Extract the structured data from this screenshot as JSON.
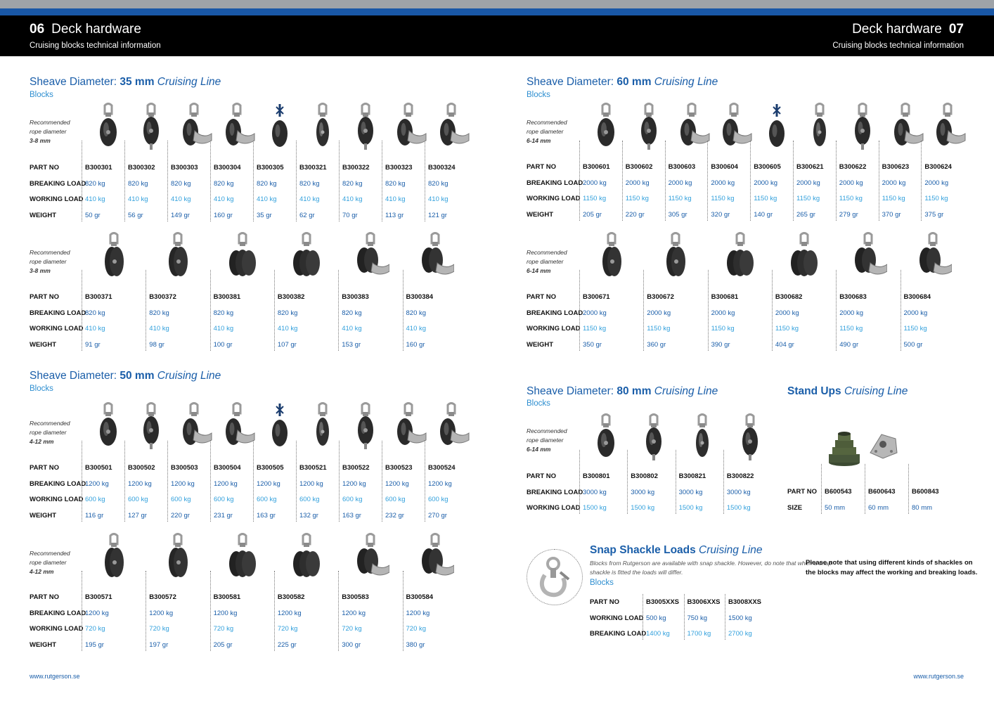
{
  "header": {
    "left_num": "06",
    "left_title": "Deck hardware",
    "left_sub": "Cruising blocks technical information",
    "right_num": "07",
    "right_title": "Deck hardware",
    "right_sub": "Cruising blocks technical information"
  },
  "labels": {
    "rec1": "Recommended",
    "rec2": "rope diameter",
    "part_no": "PART NO",
    "breaking": "BREAKING LOAD",
    "working": "WORKING LOAD",
    "weight": "WEIGHT",
    "size": "SIZE"
  },
  "s35": {
    "title_pre": "Sheave Diameter: ",
    "title_bold": "35 mm",
    "title_it": " Cruising Line",
    "sub": "Blocks",
    "rope": "3-8 mm",
    "t1": {
      "parts": [
        "B300301",
        "B300302",
        "B300303",
        "B300304",
        "B300305",
        "B300321",
        "B300322",
        "B300323",
        "B300324"
      ],
      "breaking": [
        "820 kg",
        "820 kg",
        "820 kg",
        "820 kg",
        "820 kg",
        "820 kg",
        "820 kg",
        "820 kg",
        "820 kg"
      ],
      "working": [
        "410 kg",
        "410 kg",
        "410 kg",
        "410 kg",
        "410 kg",
        "410 kg",
        "410 kg",
        "410 kg",
        "410 kg"
      ],
      "weight": [
        "50 gr",
        "56 gr",
        "149 gr",
        "160 gr",
        "35 gr",
        "62 gr",
        "70 gr",
        "113 gr",
        "121 gr"
      ]
    },
    "t2": {
      "parts": [
        "B300371",
        "B300372",
        "B300381",
        "B300382",
        "B300383",
        "B300384"
      ],
      "breaking": [
        "820 kg",
        "820 kg",
        "820 kg",
        "820 kg",
        "820 kg",
        "820 kg"
      ],
      "working": [
        "410 kg",
        "410 kg",
        "410 kg",
        "410 kg",
        "410 kg",
        "410 kg"
      ],
      "weight": [
        "91 gr",
        "98 gr",
        "100 gr",
        "107 gr",
        "153 gr",
        "160 gr"
      ]
    }
  },
  "s50": {
    "title_pre": "Sheave Diameter: ",
    "title_bold": "50 mm",
    "title_it": " Cruising Line",
    "sub": "Blocks",
    "rope": "4-12 mm",
    "t1": {
      "parts": [
        "B300501",
        "B300502",
        "B300503",
        "B300504",
        "B300505",
        "B300521",
        "B300522",
        "B300523",
        "B300524"
      ],
      "breaking": [
        "1200 kg",
        "1200 kg",
        "1200 kg",
        "1200 kg",
        "1200 kg",
        "1200 kg",
        "1200 kg",
        "1200 kg",
        "1200 kg"
      ],
      "working": [
        "600 kg",
        "600 kg",
        "600 kg",
        "600 kg",
        "600 kg",
        "600 kg",
        "600 kg",
        "600 kg",
        "600 kg"
      ],
      "weight": [
        "116 gr",
        "127 gr",
        "220 gr",
        "231 gr",
        "163 gr",
        "132 gr",
        "163 gr",
        "232 gr",
        "270 gr"
      ]
    },
    "t2": {
      "parts": [
        "B300571",
        "B300572",
        "B300581",
        "B300582",
        "B300583",
        "B300584"
      ],
      "breaking": [
        "1200 kg",
        "1200 kg",
        "1200 kg",
        "1200 kg",
        "1200 kg",
        "1200 kg"
      ],
      "working": [
        "720 kg",
        "720 kg",
        "720 kg",
        "720 kg",
        "720 kg",
        "720 kg"
      ],
      "weight": [
        "195 gr",
        "197 gr",
        "205 gr",
        "225 gr",
        "300 gr",
        "380 gr"
      ]
    }
  },
  "s60": {
    "title_pre": "Sheave Diameter: ",
    "title_bold": "60 mm",
    "title_it": " Cruising Line",
    "sub": "Blocks",
    "rope": "6-14 mm",
    "t1": {
      "parts": [
        "B300601",
        "B300602",
        "B300603",
        "B300604",
        "B300605",
        "B300621",
        "B300622",
        "B300623",
        "B300624"
      ],
      "breaking": [
        "2000 kg",
        "2000 kg",
        "2000 kg",
        "2000 kg",
        "2000 kg",
        "2000 kg",
        "2000 kg",
        "2000 kg",
        "2000 kg"
      ],
      "working": [
        "1150 kg",
        "1150 kg",
        "1150 kg",
        "1150 kg",
        "1150 kg",
        "1150 kg",
        "1150 kg",
        "1150 kg",
        "1150 kg"
      ],
      "weight": [
        "205 gr",
        "220 gr",
        "305 gr",
        "320 gr",
        "140 gr",
        "265 gr",
        "279 gr",
        "370 gr",
        "375 gr"
      ]
    },
    "t2": {
      "parts": [
        "B300671",
        "B300672",
        "B300681",
        "B300682",
        "B300683",
        "B300684"
      ],
      "breaking": [
        "2000 kg",
        "2000 kg",
        "2000 kg",
        "2000 kg",
        "2000 kg",
        "2000 kg"
      ],
      "working": [
        "1150 kg",
        "1150 kg",
        "1150 kg",
        "1150 kg",
        "1150 kg",
        "1150 kg"
      ],
      "weight": [
        "350 gr",
        "360 gr",
        "390 gr",
        "404 gr",
        "490 gr",
        "500 gr"
      ]
    }
  },
  "s80": {
    "title_pre": "Sheave Diameter: ",
    "title_bold": "80 mm",
    "title_it": " Cruising Line",
    "sub": "Blocks",
    "rope": "6-14 mm",
    "t1": {
      "parts": [
        "B300801",
        "B300802",
        "B300821",
        "B300822"
      ],
      "breaking": [
        "3000 kg",
        "3000 kg",
        "3000 kg",
        "3000 kg"
      ],
      "working": [
        "1500 kg",
        "1500 kg",
        "1500 kg",
        "1500 kg"
      ]
    }
  },
  "standups": {
    "title_bold": "Stand Ups",
    "title_it": " Cruising Line",
    "parts": [
      "B600543",
      "B600643",
      "B600843"
    ],
    "size": [
      "50 mm",
      "60 mm",
      "80 mm"
    ]
  },
  "snap": {
    "title_bold": "Snap Shackle Loads",
    "title_it": " Cruising Line",
    "desc1": "Blocks from Rutgerson are available with snap shackle. However, do note that when a snap",
    "desc2": "shackle is fitted the loads will differ.",
    "sub": "Blocks",
    "parts": [
      "B3005XXS",
      "B3006XXS",
      "B3008XXS"
    ],
    "working": [
      "500 kg",
      "750 kg",
      "1500 kg"
    ],
    "breaking": [
      "1400 kg",
      "1700 kg",
      "2700 kg"
    ],
    "note1": "Please note that using different kinds of shackles on",
    "note2": "the blocks may affect the working and breaking loads."
  },
  "footer": {
    "left": "www.rutgerson.se",
    "right": "www.rutgerson.se"
  },
  "colors": {
    "title": "#1a5ea9",
    "working": "#32a0dc",
    "header_bg": "#000000",
    "top_blue": "#1957a6"
  }
}
